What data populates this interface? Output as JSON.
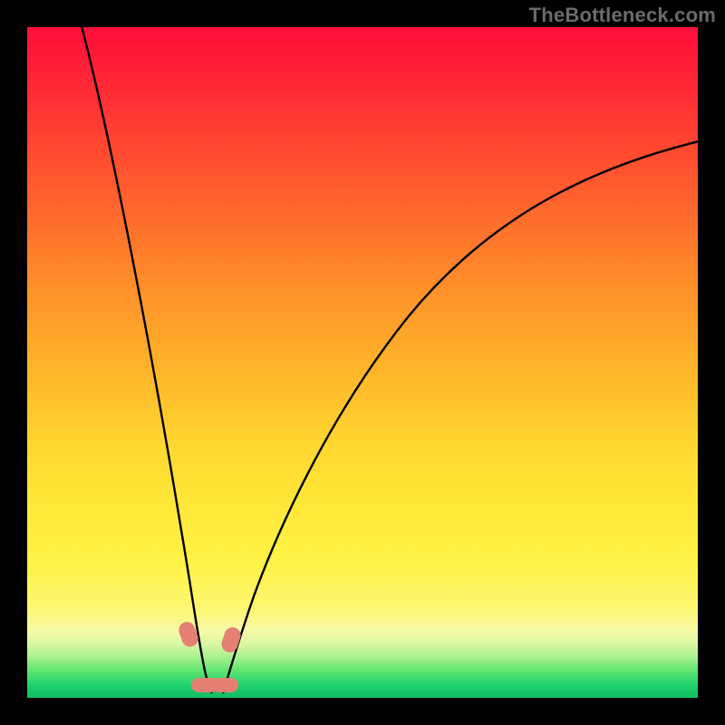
{
  "watermark": "TheBottleneck.com",
  "chart_data": {
    "type": "line",
    "title": "",
    "xlabel": "",
    "ylabel": "",
    "xlim": [
      0,
      100
    ],
    "ylim": [
      0,
      100
    ],
    "background_gradient": {
      "top": "#ff0f3a",
      "mid": "#ffea3e",
      "bottom": "#15c060"
    },
    "series": [
      {
        "name": "left-branch",
        "x": [
          8,
          10,
          12,
          14,
          16,
          18,
          20,
          22,
          23.5,
          25,
          26,
          27
        ],
        "values": [
          100,
          88,
          76,
          64,
          53,
          42,
          31,
          20,
          12,
          6,
          3,
          1
        ]
      },
      {
        "name": "right-branch",
        "x": [
          30,
          32,
          35,
          40,
          46,
          54,
          62,
          72,
          82,
          92,
          100
        ],
        "values": [
          1,
          4,
          10,
          21,
          33,
          46,
          57,
          67,
          75,
          80,
          83
        ]
      }
    ],
    "markers": [
      {
        "name": "marker-left-upper",
        "x": 24.0,
        "y": 9.5
      },
      {
        "name": "marker-right-upper",
        "x": 30.0,
        "y": 8.5
      },
      {
        "name": "marker-bottom-left",
        "x": 26.3,
        "y": 2.0
      },
      {
        "name": "marker-bottom-right",
        "x": 29.3,
        "y": 2.0
      }
    ],
    "colors": {
      "curve": "#000000",
      "marker": "#e58074",
      "watermark": "#6b6b6b"
    }
  }
}
